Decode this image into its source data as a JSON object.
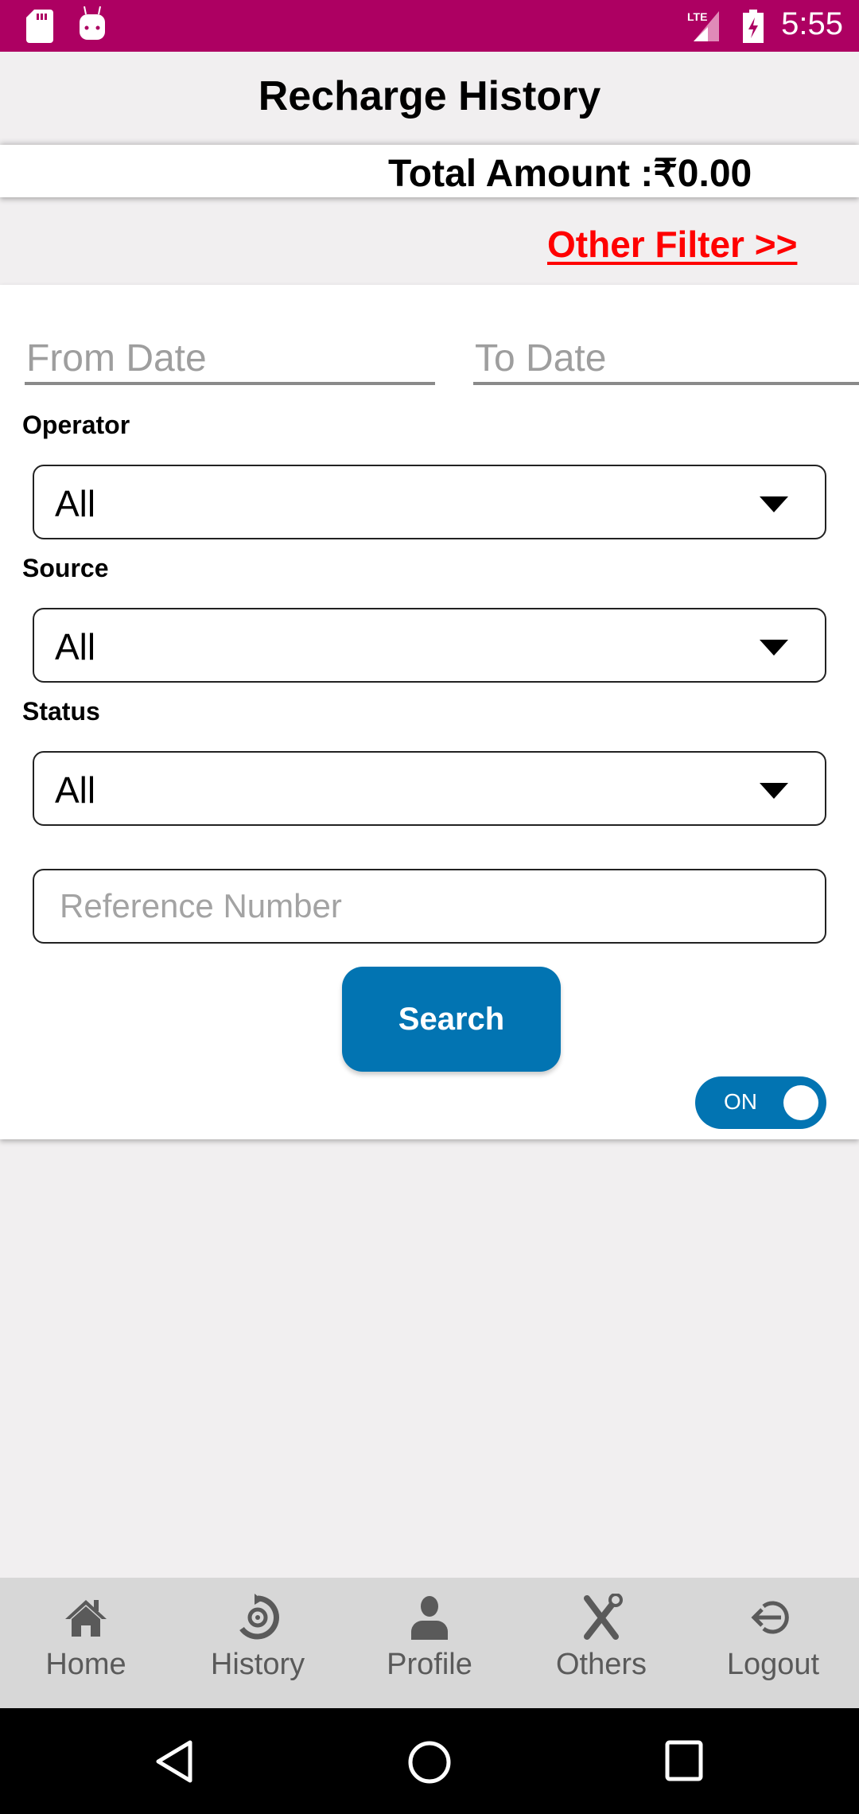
{
  "status_bar": {
    "time": "5:55",
    "network": "LTE",
    "icons": [
      "sd-card-icon",
      "android-debug-icon",
      "lte-signal-icon",
      "battery-charging-icon"
    ]
  },
  "header": {
    "title": "Recharge History"
  },
  "summary": {
    "total_label": "Total Amount :",
    "total_value": "₹0.00",
    "total_text": "Total Amount :₹0.00"
  },
  "filters": {
    "other_filter_link": "Other Filter >>",
    "from_date_placeholder": "From Date",
    "to_date_placeholder": "To Date",
    "operator": {
      "label": "Operator",
      "selected": "All"
    },
    "source": {
      "label": "Source",
      "selected": "All"
    },
    "status": {
      "label": "Status",
      "selected": "All"
    },
    "reference_placeholder": "Reference Number",
    "reference_value": "",
    "search_button": "Search",
    "toggle": {
      "label": "ON",
      "state": true
    }
  },
  "colors": {
    "status_bar": "#ad0062",
    "accent": "#0274b2",
    "link": "#ff0000"
  },
  "bottom_nav": {
    "items": [
      {
        "label": "Home",
        "icon": "home-icon"
      },
      {
        "label": "History",
        "icon": "history-icon"
      },
      {
        "label": "Profile",
        "icon": "profile-icon"
      },
      {
        "label": "Others",
        "icon": "tools-icon"
      },
      {
        "label": "Logout",
        "icon": "logout-icon"
      }
    ]
  },
  "system_nav": {
    "buttons": [
      "back",
      "home",
      "recents"
    ]
  }
}
